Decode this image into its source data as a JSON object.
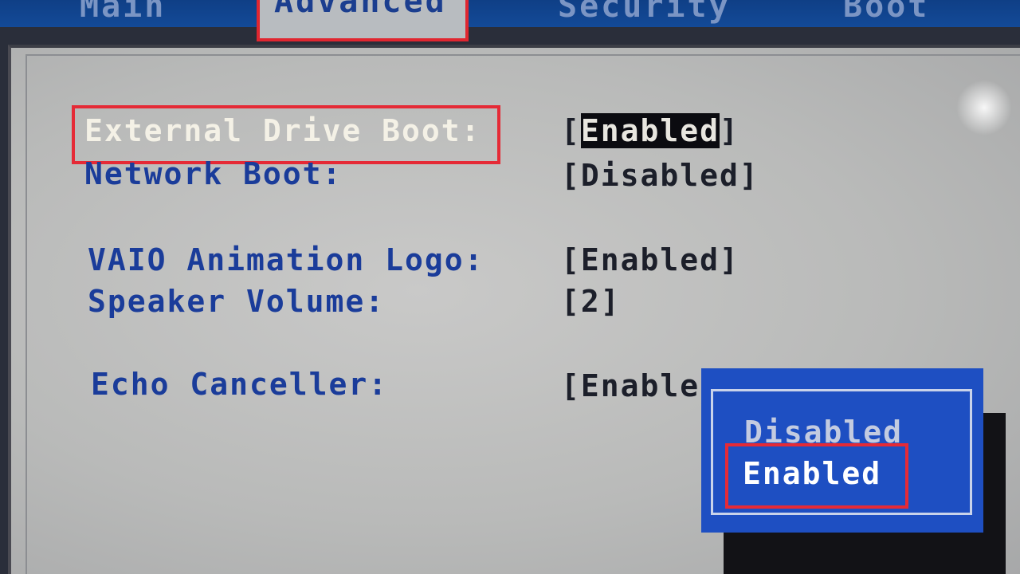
{
  "tabs": {
    "main": "Main",
    "advanced": "Advanced",
    "security": "Security",
    "boot": "Boot"
  },
  "settings": {
    "external_drive_boot": {
      "label": "External Drive Boot:",
      "value_open": "[",
      "value": "Enabled",
      "value_close": "]"
    },
    "network_boot": {
      "label": "Network Boot:",
      "value": "[Disabled]"
    },
    "vaio_animation_logo": {
      "label": "VAIO Animation Logo:",
      "value": "[Enabled]"
    },
    "speaker_volume": {
      "label": "Speaker Volume:",
      "value": "[2]"
    },
    "echo_canceller": {
      "label": "Echo Canceller:",
      "value": "[Enable"
    }
  },
  "popup": {
    "options": [
      "Disabled",
      "Enabled"
    ],
    "selected": "Enabled"
  },
  "colors": {
    "tab_bar": "#134a98",
    "panel_bg": "#c0c0c0",
    "label_blue": "#1a3c9a",
    "highlight_red": "#e52a36",
    "popup_blue": "#1e4fc2"
  }
}
